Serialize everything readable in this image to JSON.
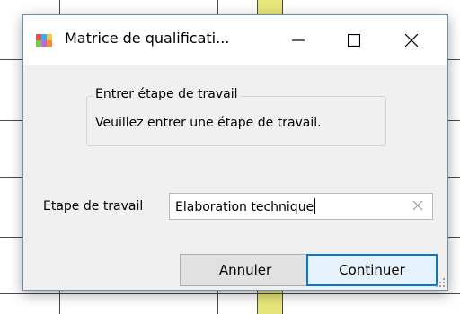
{
  "window": {
    "title": "Matrice de qualificati...",
    "controls": [
      "minimize-icon",
      "maximize-icon",
      "close-icon"
    ]
  },
  "group": {
    "legend": "Entrer étape de travail",
    "message": "Veuillez entrer une étape de travail."
  },
  "field": {
    "label": "Etape de travail",
    "value": "Elaboration technique"
  },
  "buttons": {
    "cancel": "Annuler",
    "continue": "Continuer"
  },
  "colors": {
    "dialog_bg": "#f0f0f0",
    "accent": "#0078d7",
    "grid_highlight": "#e7e67a"
  }
}
